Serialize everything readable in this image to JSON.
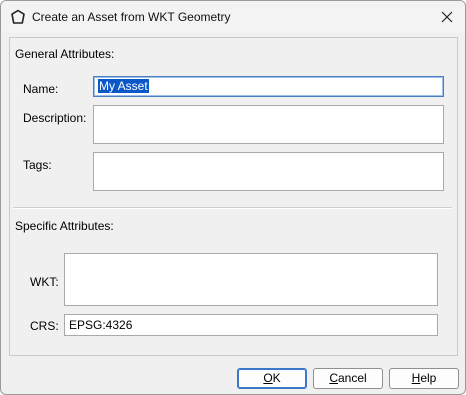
{
  "window": {
    "title": "Create an Asset from WKT Geometry",
    "icon": "asset-outline-icon",
    "close_icon": "close-icon"
  },
  "general": {
    "section_label": "General Attributes:",
    "name_label": "Name:",
    "name_value": "My Asset",
    "description_label": "Description:",
    "description_value": "",
    "tags_label": "Tags:",
    "tags_value": ""
  },
  "specific": {
    "section_label": "Specific Attributes:",
    "wkt_label": "WKT:",
    "wkt_value": "",
    "crs_label": "CRS:",
    "crs_value": "EPSG:4326"
  },
  "buttons": {
    "ok_mnemonic": "O",
    "ok_rest": "K",
    "cancel_mnemonic": "C",
    "cancel_rest": "ancel",
    "help_mnemonic": "H",
    "help_rest": "elp"
  },
  "colors": {
    "selection": "#0a57c7",
    "focus_border": "#4a7fbf",
    "default_button_border": "#3a78c9"
  }
}
